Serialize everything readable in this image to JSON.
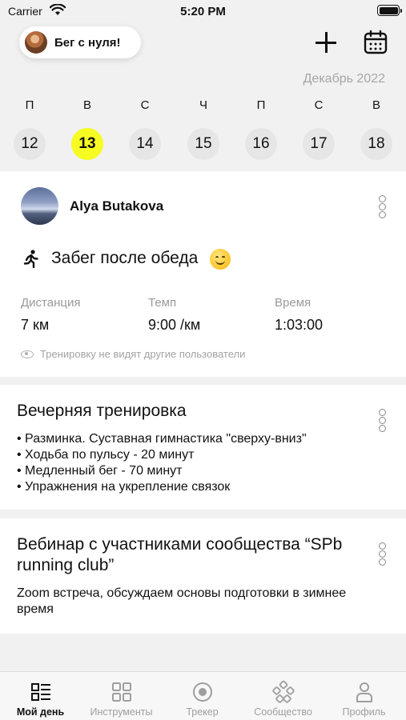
{
  "status_bar": {
    "carrier": "Carrier",
    "time": "5:20 PM"
  },
  "header": {
    "plan_title": "Бег с нуля!",
    "month": "Декабрь 2022"
  },
  "week": {
    "days": [
      {
        "letter": "П",
        "number": "12"
      },
      {
        "letter": "В",
        "number": "13",
        "active": true
      },
      {
        "letter": "С",
        "number": "14"
      },
      {
        "letter": "Ч",
        "number": "15"
      },
      {
        "letter": "П",
        "number": "16"
      },
      {
        "letter": "С",
        "number": "17"
      },
      {
        "letter": "В",
        "number": "18"
      }
    ],
    "accent_color": "#f6fb22"
  },
  "workout_card": {
    "user_name": "Alya Butakova",
    "title": "Забег после обеда",
    "stats": [
      {
        "label": "Дистанция",
        "value": "7 км"
      },
      {
        "label": "Темп",
        "value": "9:00 /км"
      },
      {
        "label": "Время",
        "value": "1:03:00"
      }
    ],
    "privacy_note": "Тренировку не видят другие пользователи"
  },
  "plan_card": {
    "title": "Вечерняя тренировка",
    "bullets": [
      "• Разминка. Суставная гимнастика \"сверху-вниз\"",
      "• Ходьба по пульсу - 20 минут",
      "• Медленный бег - 70 минут",
      "• Упражнения на укрепление связок"
    ]
  },
  "event_card": {
    "title": "Вебинар с участниками сообщества “SPb running club”",
    "description": "Zoom встреча, обсуждаем основы подготовки в зимнее время"
  },
  "tab_bar": {
    "tabs": [
      {
        "label": "Мой день",
        "icon": "my-day-icon",
        "active": true
      },
      {
        "label": "Инструменты",
        "icon": "tools-icon"
      },
      {
        "label": "Трекер",
        "icon": "tracker-icon"
      },
      {
        "label": "Сообщество",
        "icon": "community-icon"
      },
      {
        "label": "Профиль",
        "icon": "profile-icon"
      }
    ]
  }
}
